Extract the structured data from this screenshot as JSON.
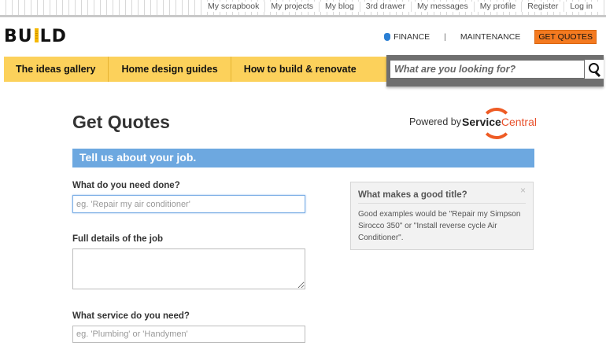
{
  "toplinks": [
    "My scrapbook",
    "My projects",
    "My blog",
    "3rd drawer",
    "My messages",
    "My profile",
    "Register",
    "Log in"
  ],
  "logo": {
    "pre": "BU",
    "post": "LD"
  },
  "header": {
    "finance": "FINANCE",
    "separator": "|",
    "maintenance": "MAINTENANCE",
    "get_quotes": "GET QUOTES"
  },
  "nav": [
    "The ideas gallery",
    "Home design guides",
    "How to build & renovate"
  ],
  "search": {
    "placeholder": "What are you looking for?"
  },
  "main": {
    "title": "Get Quotes",
    "powered_by": "Powered by",
    "brand_a": "Service",
    "brand_b": "Central",
    "banner": "Tell us about your job.",
    "q1_label": "What do you need done?",
    "q1_placeholder": "eg. 'Repair my air conditioner'",
    "q2_label": "Full details of the job",
    "q3_label": "What service do you need?",
    "q3_placeholder": "eg. 'Plumbing' or 'Handymen'"
  },
  "tip": {
    "title": "What makes a good title?",
    "close": "×",
    "body": "Good examples would be \"Repair my Simpson Sirocco 350\" or \"Install reverse cycle Air Conditioner\"."
  },
  "colors": {
    "nav": "#fcd15b",
    "banner": "#6da8e0",
    "get_quotes": "#f47a20",
    "brand": "#ee5b24"
  }
}
